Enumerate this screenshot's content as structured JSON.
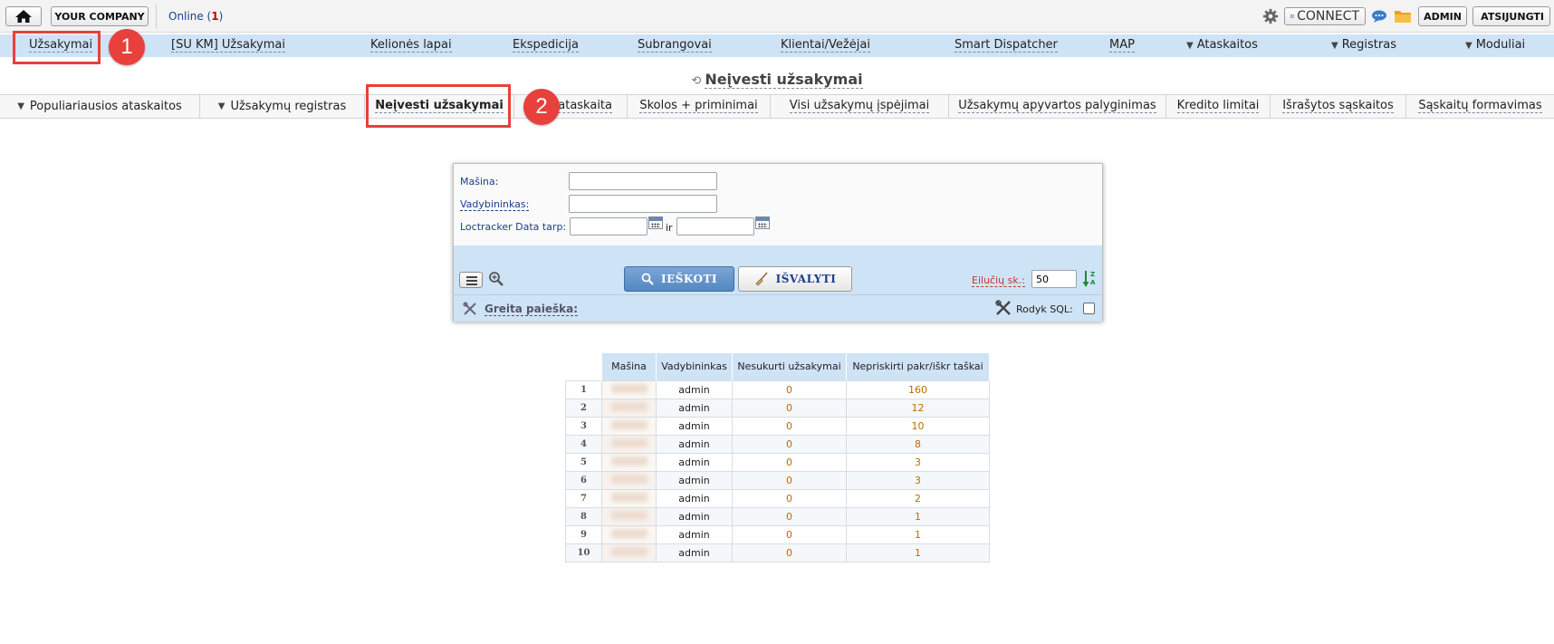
{
  "topbar": {
    "company": "YOUR COMPANY",
    "online_label": "Online (",
    "online_count": "1",
    "online_close": ")",
    "connect": "CONNECT",
    "admin": "ADMIN",
    "logout": "ATSIJUNGTI"
  },
  "mainnav": [
    "Užsakymai",
    "[SU KM] Užsakymai",
    "Kelionės lapai",
    "Ekspedicija",
    "Subrangovai",
    "Klientai/Vežėjai",
    "Smart Dispatcher",
    "MAP",
    "Ataskaitos",
    "Registras",
    "Moduliai"
  ],
  "page_title": "Neįvesti užsakymai",
  "subtabs": [
    "Populiariausios ataskaitos",
    "Užsakymų registras",
    "Neįvesti užsakymai",
    "ataskaita",
    "Skolos + priminimai",
    "Visi užsakymų įspėjimai",
    "Užsakymų apyvartos palyginimas",
    "Kredito limitai",
    "Išrašytos sąskaitos",
    "Sąskaitų formavimas"
  ],
  "annotations": {
    "badge1": "1",
    "badge2": "2"
  },
  "filter": {
    "masina_label": "Mašina:",
    "vadybininkas_label": "Vadybininkas:",
    "loctracker_label": "Loctracker Data tarp:",
    "ir_label": "ir",
    "search_button": "IEŠKOTI",
    "clear_button": "IŠVALYTI",
    "rows_label": "Eilučių sk.:",
    "rows_value": "50",
    "quick_search": "Greita paieška:",
    "sql_label": "Rodyk SQL:"
  },
  "table": {
    "headers": [
      "Mašina",
      "Vadybininkas",
      "Nesukurti užsakymai",
      "Nepriskirti pakr/iškr taškai"
    ],
    "rows": [
      {
        "n": "1",
        "manager": "admin",
        "orders": "0",
        "points": "160"
      },
      {
        "n": "2",
        "manager": "admin",
        "orders": "0",
        "points": "12"
      },
      {
        "n": "3",
        "manager": "admin",
        "orders": "0",
        "points": "10"
      },
      {
        "n": "4",
        "manager": "admin",
        "orders": "0",
        "points": "8"
      },
      {
        "n": "5",
        "manager": "admin",
        "orders": "0",
        "points": "3"
      },
      {
        "n": "6",
        "manager": "admin",
        "orders": "0",
        "points": "3"
      },
      {
        "n": "7",
        "manager": "admin",
        "orders": "0",
        "points": "2"
      },
      {
        "n": "8",
        "manager": "admin",
        "orders": "0",
        "points": "1"
      },
      {
        "n": "9",
        "manager": "admin",
        "orders": "0",
        "points": "1"
      },
      {
        "n": "10",
        "manager": "admin",
        "orders": "0",
        "points": "1"
      }
    ]
  },
  "colors": {
    "nav_bg": "#cfe3f6",
    "annotation_red": "#e8403c",
    "primary_button": "#5e8fc8",
    "link_blue": "#1c3f8a",
    "value_orange": "#c06a00"
  }
}
